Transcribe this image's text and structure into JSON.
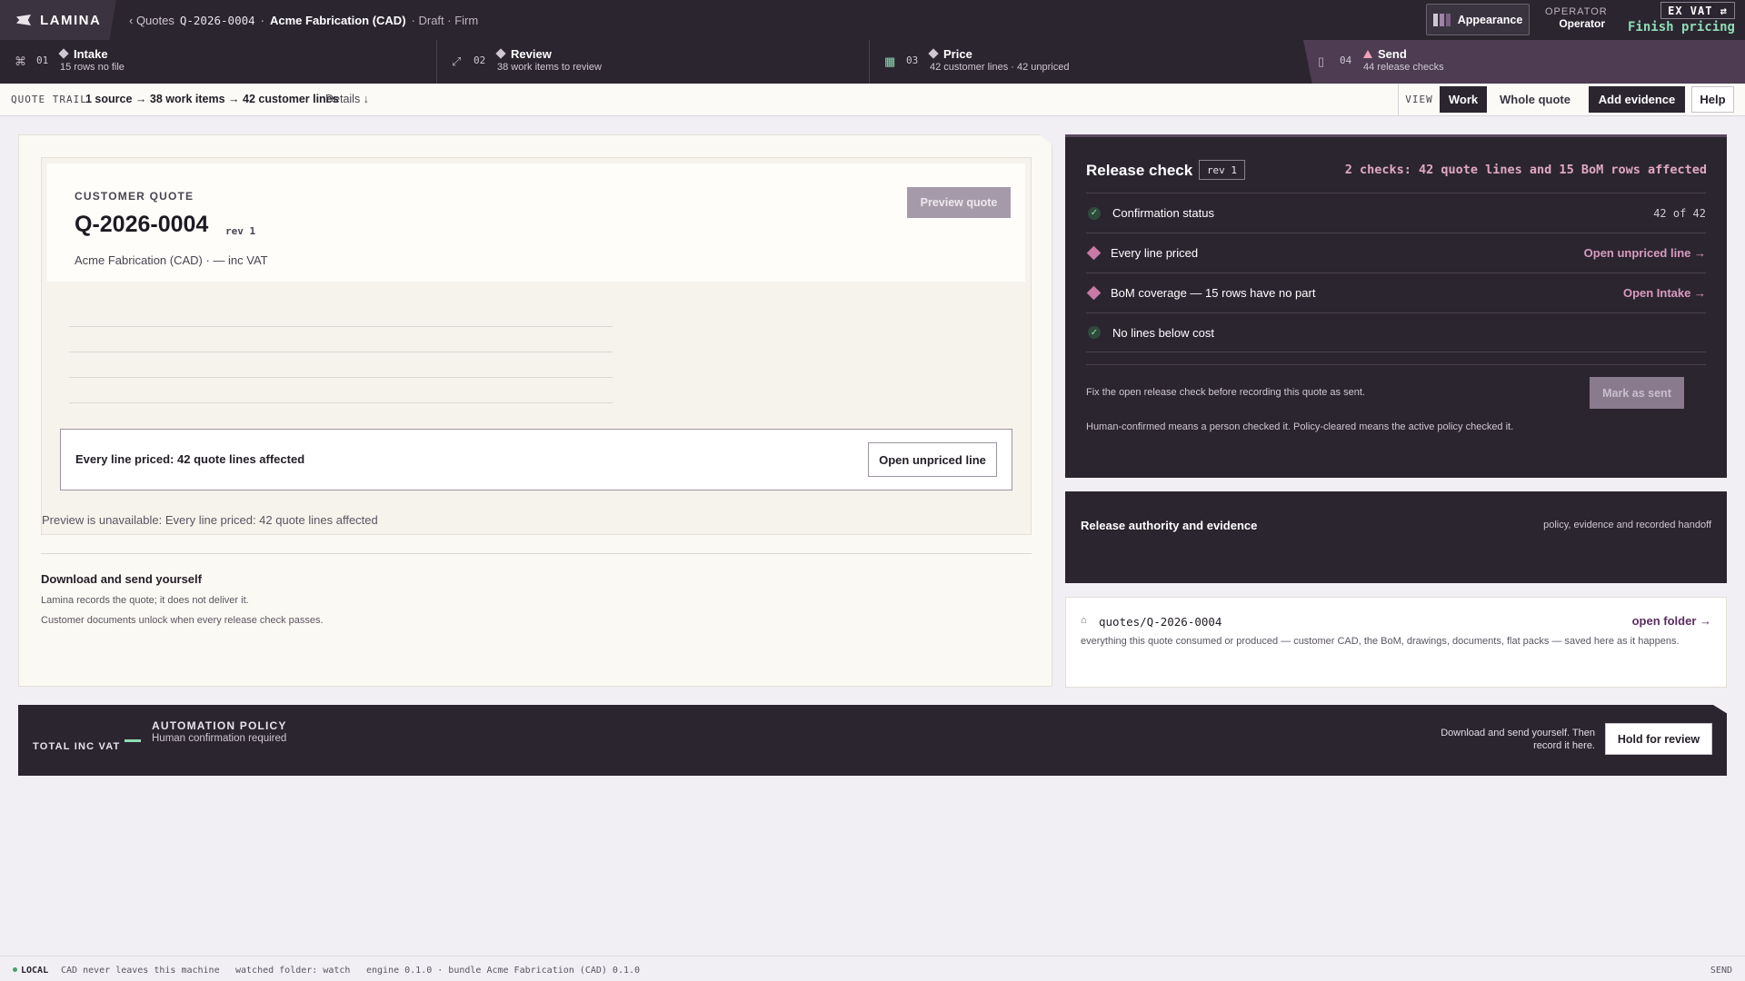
{
  "app": {
    "name": "LAMINA"
  },
  "breadcrumb": {
    "back": "‹ Quotes",
    "quote_id": "Q-2026-0004",
    "sep": "·",
    "customer": "Acme Fabrication (CAD)",
    "status": "· Draft · Firm"
  },
  "topbar": {
    "appearance": "Appearance",
    "operator_label": "OPERATOR",
    "operator_value": "Operator",
    "vat_toggle": "EX VAT ⇄",
    "finish": "Finish pricing"
  },
  "steps": [
    {
      "num": "01",
      "title": "Intake",
      "sub": "15 rows no file",
      "icon": "intake-icon"
    },
    {
      "num": "02",
      "title": "Review",
      "sub": "38 work items to review",
      "icon": "review-icon"
    },
    {
      "num": "03",
      "title": "Price",
      "sub": "42 customer lines · 42 unpriced",
      "icon": "price-icon"
    },
    {
      "num": "04",
      "title": "Send",
      "sub": "44 release checks",
      "icon": "send-icon"
    }
  ],
  "trail": {
    "label": "QUOTE TRAIL",
    "path": "1 source → 38 work items → 42 customer lines",
    "details": "Details ↓"
  },
  "view": {
    "label": "VIEW",
    "work": "Work",
    "whole": "Whole quote",
    "add_evidence": "Add evidence",
    "help": "Help"
  },
  "quote": {
    "label": "CUSTOMER QUOTE",
    "id": "Q-2026-0004",
    "rev": "rev 1",
    "customer_line": "Acme Fabrication (CAD) · — inc VAT",
    "preview_btn": "Preview quote",
    "alert": "Every line priced: 42 quote lines affected",
    "alert_btn": "Open unpriced line",
    "preview_note": "Preview is unavailable: Every line priced: 42 quote lines affected"
  },
  "download": {
    "title": "Download and send yourself",
    "line1": "Lamina records the quote; it does not deliver it.",
    "line2": "Customer documents unlock when every release check passes."
  },
  "release": {
    "title": "Release check",
    "rev": "rev 1",
    "summary": "2 checks: 42 quote lines and 15 BoM rows affected",
    "checks": [
      {
        "label": "Confirmation status",
        "value": "42 of 42",
        "status": "pass"
      },
      {
        "label": "Every line priced",
        "link": "Open unpriced line →",
        "status": "fail"
      },
      {
        "label": "BoM coverage — 15 rows have no part",
        "link": "Open Intake →",
        "status": "fail"
      },
      {
        "label": "No lines below cost",
        "status": "pass"
      }
    ],
    "note": "Fix the open release check before recording this quote as sent.",
    "mark_btn": "Mark as sent",
    "footnote": "Human-confirmed means a person checked it. Policy-cleared means the active policy checked it."
  },
  "authority": {
    "title": "Release authority and evidence",
    "right": "policy, evidence and recorded handoff"
  },
  "folder": {
    "icon": "⌂",
    "path": "quotes/Q-2026-0004",
    "link": "open folder →",
    "desc": "everything this quote consumed or produced — customer CAD, the BoM, drawings, documents, flat packs — saved here as it happens."
  },
  "policy": {
    "total_label": "TOTAL INC VAT",
    "title": "AUTOMATION POLICY",
    "sub": "Human confirmation required",
    "note": "Download and send yourself. Then record it here.",
    "hold_btn": "Hold for review"
  },
  "status": {
    "local": "LOCAL",
    "a": "CAD never leaves this machine",
    "b": "watched folder: watch",
    "c": "engine 0.1.0 · bundle Acme Fabrication (CAD) 0.1.0",
    "right": "SEND"
  },
  "colors": {
    "dark": "#2b2530",
    "accent_pink": "#d99ac0",
    "accent_green": "#8fdcb4",
    "diamond": "#c87aa6"
  }
}
